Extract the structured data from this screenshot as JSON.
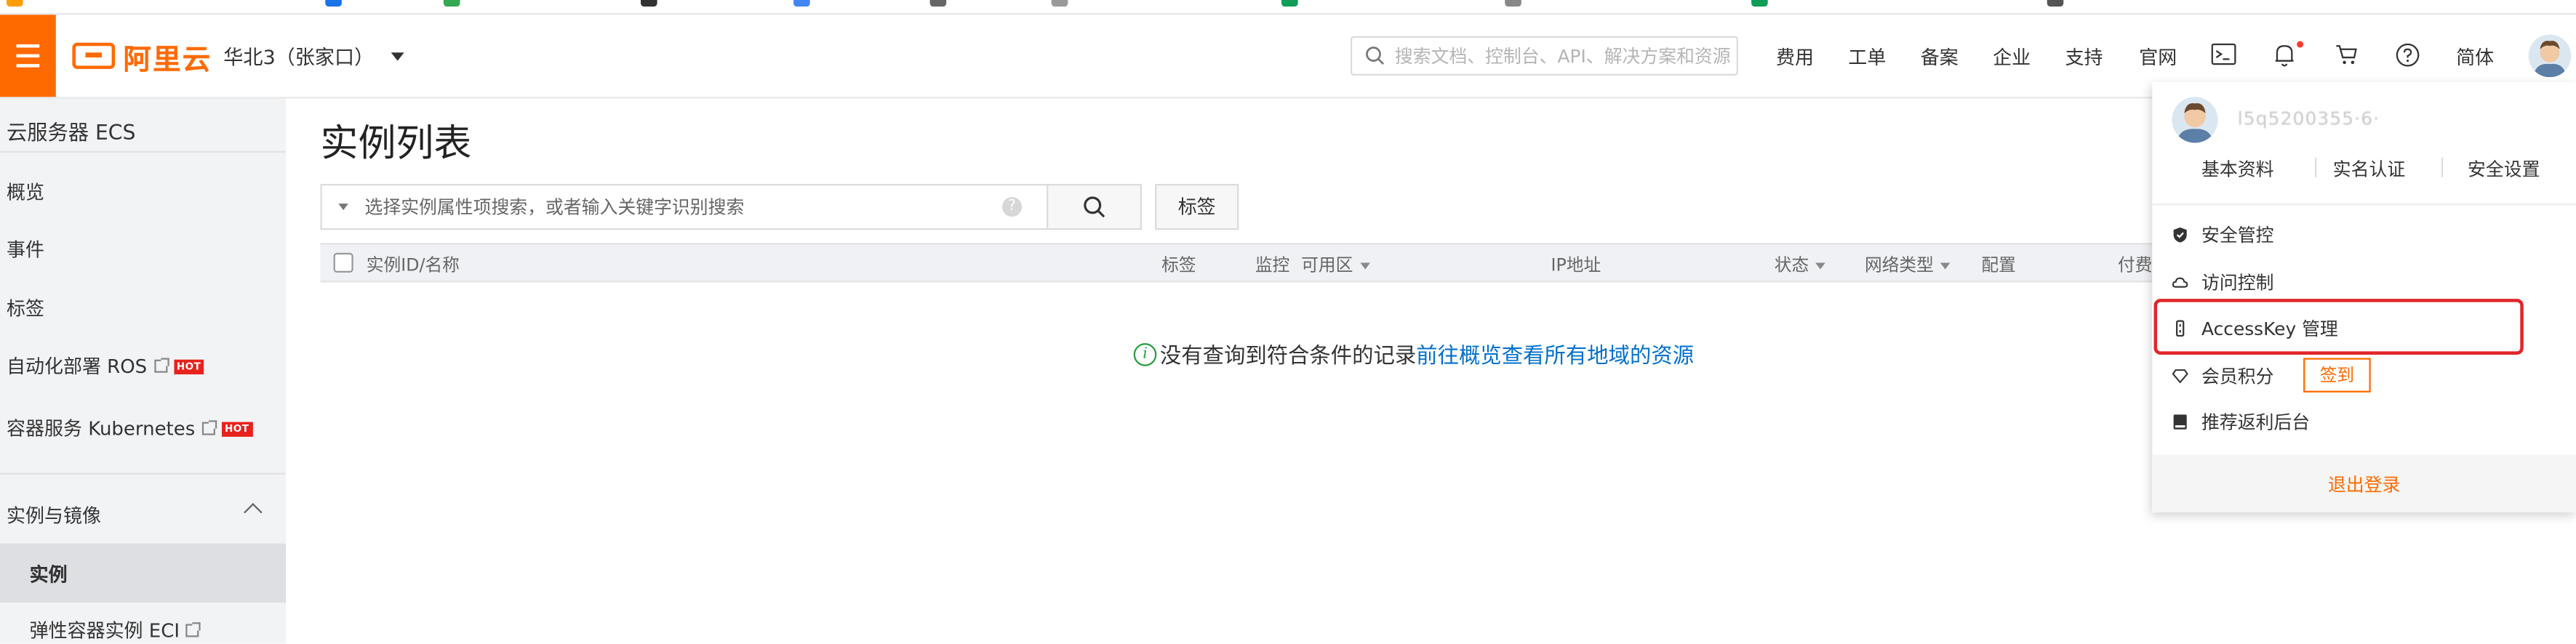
{
  "topbar": {
    "logo_text": "阿里云",
    "region": "华北3（张家口）",
    "search_placeholder": "搜索文档、控制台、API、解决方案和资源",
    "nav": [
      "费用",
      "工单",
      "备案",
      "企业",
      "支持",
      "官网"
    ],
    "language": "简体",
    "icons": [
      "terminal-icon",
      "bell-icon",
      "cart-icon",
      "help-icon"
    ],
    "accent_color": "#ff6a00"
  },
  "sidebar": {
    "title": "云服务器 ECS",
    "items": [
      {
        "label": "概览"
      },
      {
        "label": "事件"
      },
      {
        "label": "标签"
      },
      {
        "label": "自动化部署 ROS",
        "badge": "HOT"
      },
      {
        "label": "容器服务 Kubernetes",
        "badge": "HOT"
      }
    ],
    "group": {
      "label": "实例与镜像",
      "items": [
        {
          "label": "实例",
          "active": true
        },
        {
          "label": "弹性容器实例 ECI"
        }
      ]
    }
  },
  "main": {
    "title": "实例列表",
    "filter_placeholder": "选择实例属性项搜索，或者输入关键字识别搜索",
    "tag_button": "标签",
    "columns": [
      "实例ID/名称",
      "标签",
      "监控",
      "可用区",
      "IP地址",
      "状态",
      "网络类型",
      "配置",
      "付费"
    ],
    "empty_text": "没有查询到符合条件的记录",
    "empty_link": "前往概览查看所有地域的资源"
  },
  "account_menu": {
    "username_masked": "l5q5200355·6·",
    "links": [
      "基本资料",
      "实名认证",
      "安全设置"
    ],
    "items": [
      {
        "label": "安全管控",
        "icon": "shield-icon"
      },
      {
        "label": "访问控制",
        "icon": "cloud-icon"
      },
      {
        "label": "AccessKey 管理",
        "icon": "key-icon",
        "highlighted": true
      },
      {
        "label": "会员积分",
        "icon": "diamond-icon",
        "action": "签到"
      },
      {
        "label": "推荐返利后台",
        "icon": "book-icon"
      }
    ],
    "logout": "退出登录",
    "highlight_color": "#e0262a"
  }
}
